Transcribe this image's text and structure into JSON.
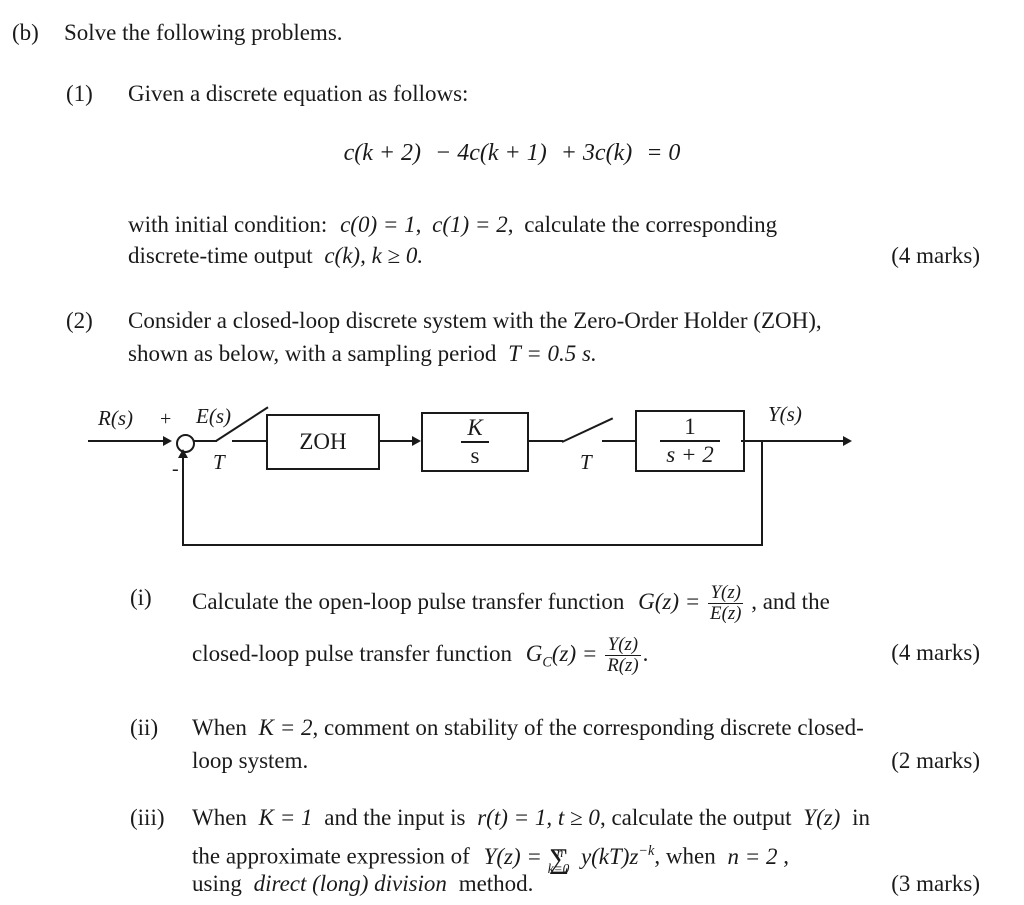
{
  "document": {
    "part_b": {
      "marker": "(b)",
      "text": "Solve the following problems."
    },
    "q1": {
      "marker": "(1)",
      "intro": "Given a discrete equation as follows:",
      "equation": {
        "c_k_plus_2": "c(k + 2)",
        "minus_4c_k_plus_1": "− 4c(k + 1)",
        "plus_3c_k": "+ 3c(k)",
        "equals_zero": "= 0",
        "full": "c(k + 2) − 4c(k + 1) + 3c(k) = 0"
      },
      "body_line1": "with  initial  condition:",
      "initial_c0": "c(0) = 1",
      "comma1": ",",
      "initial_c1": "c(1) = 2",
      "comma2": ",",
      "body_line1_tail": "calculate  the  corresponding",
      "body_line2_head": "discrete-time output",
      "output_expr": "c(k), k ≥ 0.",
      "marks": "(4 marks)"
    },
    "q2": {
      "marker": "(2)",
      "line1": "Consider  a  closed-loop  discrete  system  with  the  Zero-Order  Holder  (ZOH),",
      "line2_head": "shown as below, with a sampling period",
      "line2_math": "T = 0.5 s.",
      "sub_i": {
        "marker": "(i)",
        "text_a": "Calculate  the  open-loop  pulse  transfer  function",
        "g_of_z": "G(z) =",
        "frac1_num": "Y(z)",
        "frac1_den": "E(z)",
        "text_b": ",  and  the",
        "text_c": "closed-loop pulse transfer function",
        "gc_of_z": "G",
        "gc_sub": "C",
        "gc_tail": "(z) =",
        "frac2_num": "Y(z)",
        "frac2_den": "R(z)",
        "period": ".",
        "marks": "(4 marks)"
      },
      "sub_ii": {
        "marker": "(ii)",
        "text_head": "When",
        "k_value": "K = 2",
        "text_tail": ", comment on stability of the corresponding discrete closed-",
        "line2": "loop system.",
        "marks": "(2 marks)"
      },
      "sub_iii": {
        "marker": "(iii)",
        "l1_head": "When",
        "l1_k": "K = 1",
        "l1_mid": "and the input is",
        "l1_r": "r(t) = 1, t ≥ 0",
        "l1_tail": ", calculate the output",
        "l1_yz": "Y(z)",
        "l1_end": "in",
        "l2_head": "the  approximate  expression  of",
        "l2_yz": "Y(z) =",
        "l2_sum_sigma": "∑",
        "l2_sum_sup": "n",
        "l2_sum_sub": "k=0",
        "l2_sum_body": "y(kT)z",
        "l2_sum_exp": "−k",
        "l2_comma": ",  when",
        "l2_n": "n = 2",
        "l2_end": ",",
        "l3_head": "using",
        "l3_em": "direct (long) division",
        "l3_tail": "method.",
        "marks": "(3 marks)"
      }
    }
  },
  "block_diagram": {
    "input_label": "R(s)",
    "plus_sign": "+",
    "minus_sign": "-",
    "error_label": "E(s)",
    "sampler1_label": "T",
    "zoh_label": "ZOH",
    "gain_block": {
      "numerator": "K",
      "denominator": "s"
    },
    "sampler2_label": "T",
    "plant_block": {
      "numerator": "1",
      "denominator": "s + 2"
    },
    "output_label": "Y(s)"
  }
}
